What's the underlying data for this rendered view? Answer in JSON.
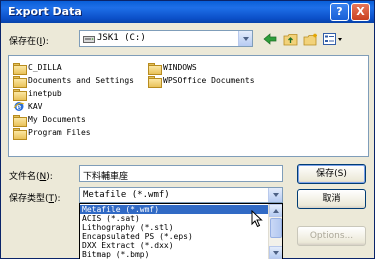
{
  "window": {
    "title": "Export Data",
    "help_glyph": "?",
    "close_glyph": "X"
  },
  "save_in": {
    "label": "保存在",
    "accel": "I",
    "suffix": "):",
    "open": "(",
    "value": "JSK1 (C:)"
  },
  "toolbar": {
    "icons": [
      "back-icon",
      "up-folder-icon",
      "new-folder-icon",
      "view-menu-icon"
    ]
  },
  "files": [
    {
      "name": "C_DILLA",
      "icon": "folder"
    },
    {
      "name": "Documents and Settings",
      "icon": "folder"
    },
    {
      "name": "inetpub",
      "icon": "folder"
    },
    {
      "name": "KAV",
      "icon": "ie"
    },
    {
      "name": "My Documents",
      "icon": "folder"
    },
    {
      "name": "Program Files",
      "icon": "folder"
    },
    {
      "name": "WINDOWS",
      "icon": "folder"
    },
    {
      "name": "WPSOffice Documents",
      "icon": "folder"
    }
  ],
  "filename": {
    "label": "文件名",
    "accel": "N",
    "suffix": "):",
    "open": "(",
    "value": "下料輔車座"
  },
  "filetype": {
    "label": "保存类型",
    "accel": "T",
    "suffix": "):",
    "open": "(",
    "value": "Metafile (*.wmf)"
  },
  "buttons": {
    "save": "保存(S)",
    "cancel": "取消",
    "options": "Options..."
  },
  "filetype_options": [
    "Metafile (*.wmf)",
    "ACIS (*.sat)",
    "Lithography (*.stl)",
    "Encapsulated PS (*.eps)",
    "DXX Extract (*.dxx)",
    "Bitmap (*.bmp)"
  ],
  "colors": {
    "title_bar": "#0b4fc8",
    "selection": "#316ac5",
    "dialog_bg": "#ece9d8"
  }
}
